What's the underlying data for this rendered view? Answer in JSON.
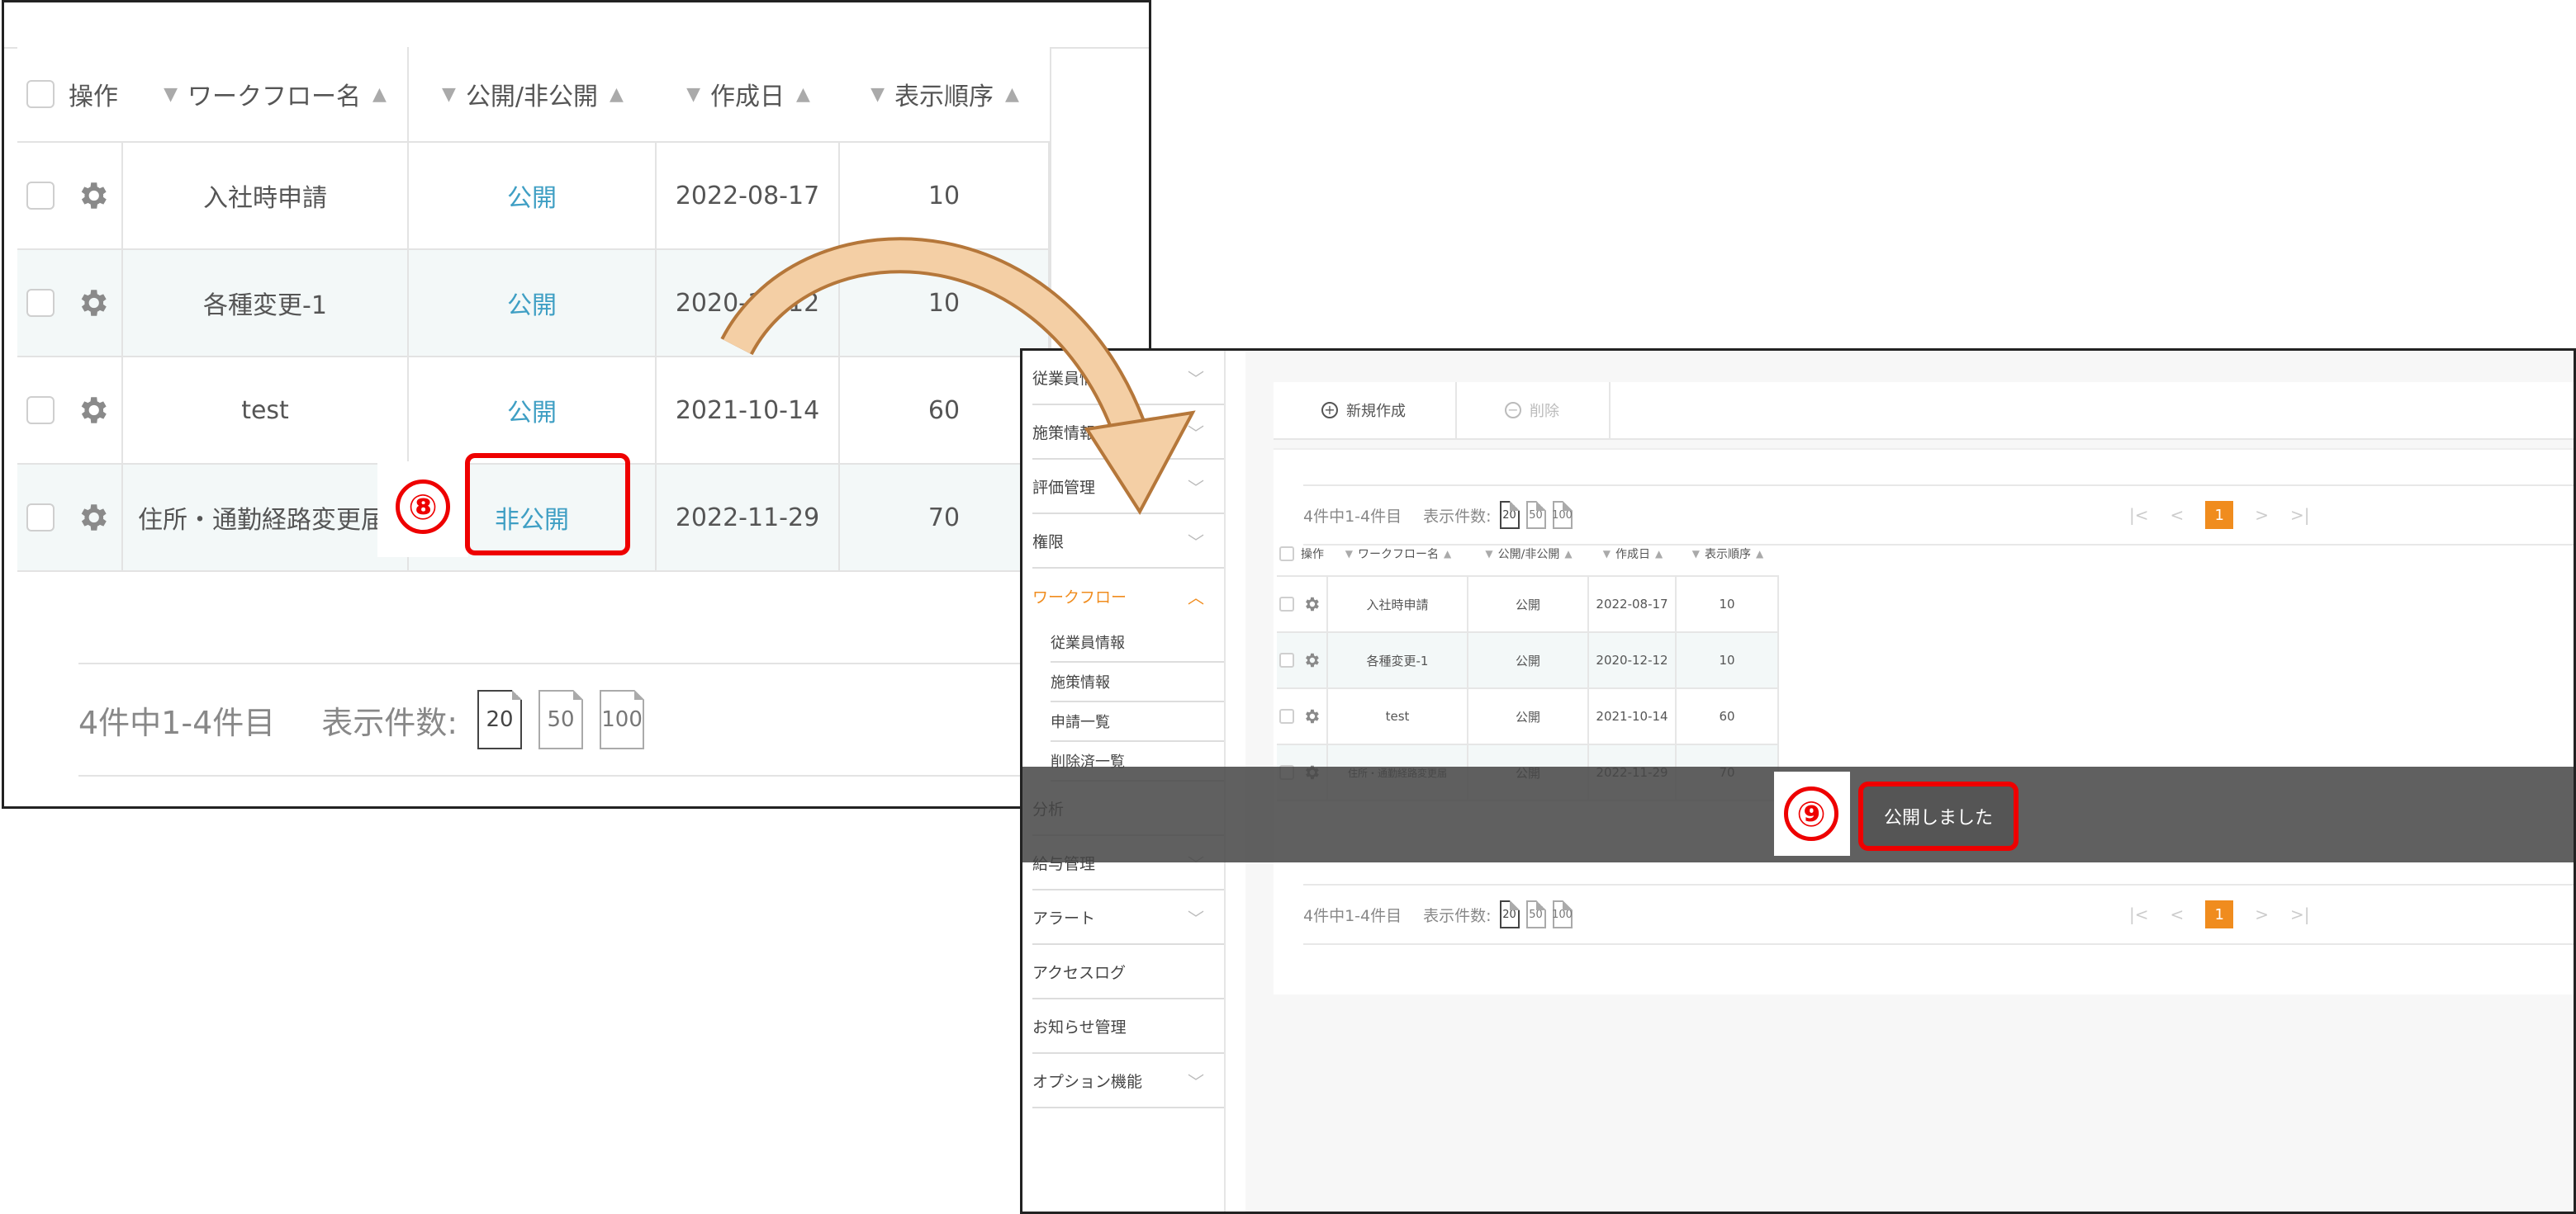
{
  "zoom_panel": {
    "headers": {
      "action": "操作",
      "name": "ワークフロー名",
      "status": "公開/非公開",
      "created": "作成日",
      "order": "表示順序"
    },
    "rows": [
      {
        "name": "入社時申請",
        "status": "公開",
        "created": "2022-08-17",
        "order": "10"
      },
      {
        "name": "各種変更-1",
        "status": "公開",
        "created": "2020-12-12",
        "order": "10"
      },
      {
        "name": "test",
        "status": "公開",
        "created": "2021-10-14",
        "order": "60"
      },
      {
        "name": "住所・通勤経路変更届",
        "status": "非公開",
        "created": "2022-11-29",
        "order": "70"
      }
    ],
    "pager_text": "4件中1-4件目",
    "page_size_label": "表示件数:",
    "page_sizes": [
      "20",
      "50",
      "100"
    ],
    "step_marker": "⑧"
  },
  "screen_panel": {
    "sidebar": [
      {
        "label": "従業員情報"
      },
      {
        "label": "施策情報"
      },
      {
        "label": "評価管理"
      },
      {
        "label": "権限"
      },
      {
        "label": "ワークフロー"
      },
      {
        "label": "分析"
      },
      {
        "label": "給与管理"
      },
      {
        "label": "アラート"
      },
      {
        "label": "アクセスログ"
      },
      {
        "label": "お知らせ管理"
      },
      {
        "label": "オプション機能"
      }
    ],
    "sidebar_sub": [
      "従業員情報",
      "施策情報",
      "申請一覧",
      "削除済一覧"
    ],
    "toolbar": {
      "new_label": "新規作成",
      "delete_label": "削除"
    },
    "pager_text": "4件中1-4件目",
    "page_size_label": "表示件数:",
    "page_sizes": [
      "20",
      "50",
      "100"
    ],
    "current_page": "1",
    "headers": {
      "action": "操作",
      "name": "ワークフロー名",
      "status": "公開/非公開",
      "created": "作成日",
      "order": "表示順序"
    },
    "rows": [
      {
        "name": "入社時申請",
        "status": "公開",
        "created": "2022-08-17",
        "order": "10"
      },
      {
        "name": "各種変更-1",
        "status": "公開",
        "created": "2020-12-12",
        "order": "10"
      },
      {
        "name": "test",
        "status": "公開",
        "created": "2021-10-14",
        "order": "60"
      },
      {
        "name": "住所・通勤経路変更届",
        "status": "公開",
        "created": "2022-11-29",
        "order": "70"
      }
    ],
    "toast": "公開しました",
    "step_marker": "⑨"
  },
  "colors": {
    "accent": "#f08c1e",
    "link": "#3f9fc4",
    "highlight": "#e00000"
  }
}
